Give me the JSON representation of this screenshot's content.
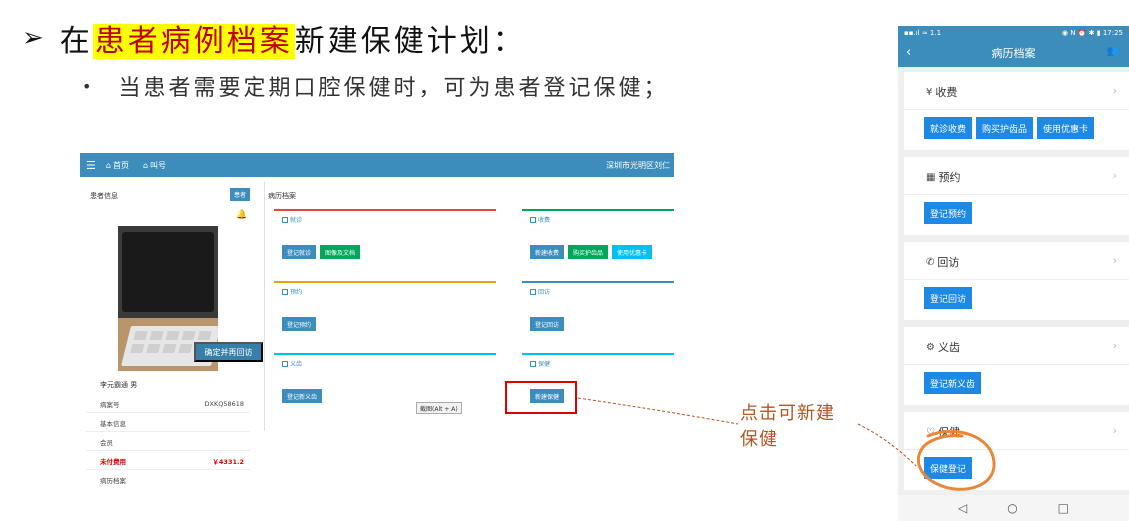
{
  "slide": {
    "bullet": "➢",
    "title_prefix": "在",
    "title_highlight": "患者病例档案",
    "title_suffix": "新建保健计划：",
    "sub_bullet": "•",
    "subtitle": "当患者需要定期口腔保健时，可为患者登记保健；"
  },
  "web": {
    "menu_icon": "☰",
    "nav_home": "首页",
    "nav_call": "叫号",
    "org": "深圳市光明区刘仁",
    "patient_info": "患者信息",
    "patient_btn": "患者",
    "confirm_btn": "确定并再回访",
    "patient_name": "李元霸通 男",
    "rows": [
      {
        "label": "病案号",
        "value": "DXKQ58618"
      },
      {
        "label": "基本信息",
        "value": ""
      },
      {
        "label": "会员",
        "value": ""
      },
      {
        "label": "未付费用",
        "value": "￥4331.2"
      },
      {
        "label": "病历档案",
        "value": ""
      }
    ],
    "breadcrumb": "病历档案",
    "cards": {
      "visit": {
        "title": "就诊",
        "buttons": [
          "登记就诊",
          "图像及文档"
        ]
      },
      "charge": {
        "title": "收费",
        "buttons": [
          "新建收费",
          "购买护齿品",
          "使用优惠卡"
        ]
      },
      "appointment": {
        "title": "预约",
        "buttons": [
          "登记预约"
        ]
      },
      "followup": {
        "title": "回访",
        "buttons": [
          "登记回访"
        ]
      },
      "denture": {
        "title": "义齿",
        "buttons": [
          "登记新义齿"
        ]
      },
      "care": {
        "title": "保健",
        "buttons": [
          "新建保健"
        ]
      }
    },
    "tooltip": "截图(Alt + A)"
  },
  "annotation": {
    "line1": "点击可新建",
    "line2": "保健"
  },
  "mobile": {
    "status_left": "▪▪.ıl ≈ 1.1",
    "status_right": "◉ N ⏰ ✱ ▮ 17:25",
    "back": "‹",
    "title": "病历档案",
    "user_icon": "👥",
    "cards": {
      "charge": {
        "title": "收费",
        "buttons": [
          "就诊收费",
          "购买护齿品",
          "使用优惠卡"
        ]
      },
      "appointment": {
        "title": "预约",
        "buttons": [
          "登记预约"
        ]
      },
      "followup": {
        "title": "回访",
        "buttons": [
          "登记回访"
        ]
      },
      "denture": {
        "title": "义齿",
        "buttons": [
          "登记新义齿"
        ]
      },
      "care": {
        "title": "保健",
        "buttons": [
          "保健登记"
        ]
      }
    },
    "nav_back": "◁",
    "nav_home": "○",
    "nav_recent": "□"
  },
  "colors": {
    "web_header": "#3c8dbc",
    "highlight": "#ffff00",
    "title_highlight_text": "#c00000",
    "annotation": "#b3561f",
    "red_box": "#e00000",
    "circle": "#e8863a",
    "mobile_button": "#1e88e5"
  }
}
